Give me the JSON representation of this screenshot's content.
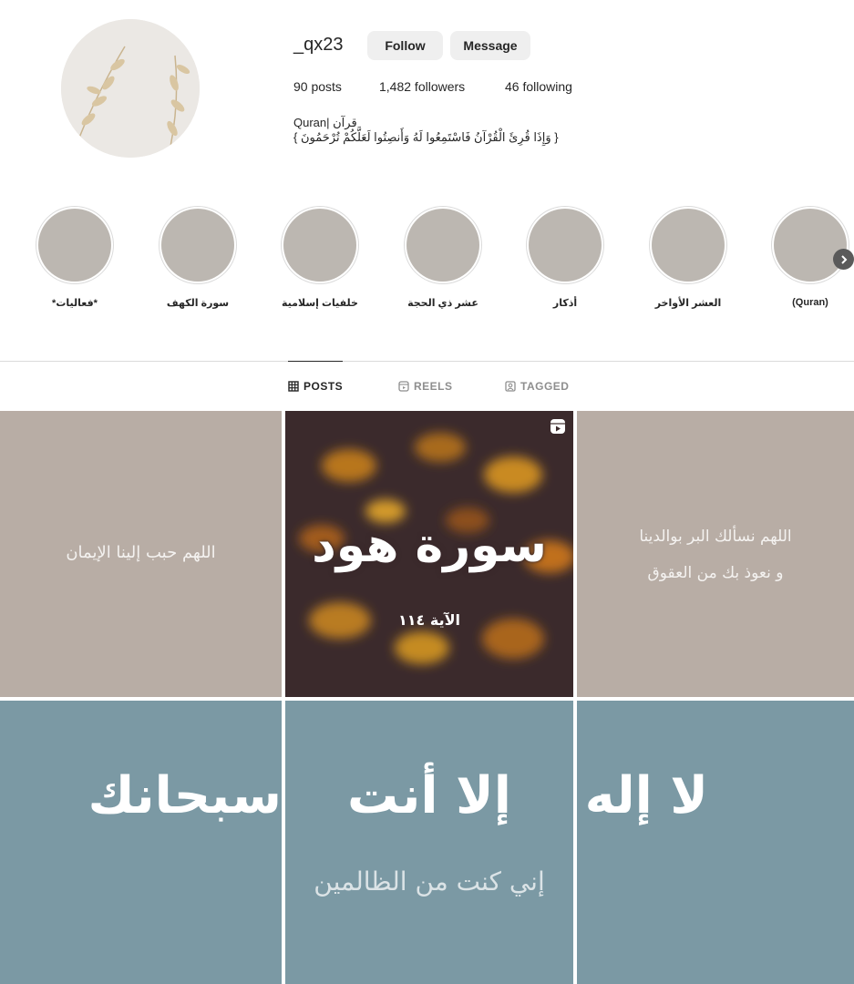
{
  "profile": {
    "username": "_qx23",
    "follow_label": "Follow",
    "message_label": "Message",
    "posts": "90 posts",
    "followers": "1,482 followers",
    "following": "46 following",
    "bio_name": "Quran| قرآن",
    "bio_text": "{ وَإِذَا قُرِئَ الْقُرْآنُ فَاسْتَمِعُوا لَهُ وَأَنصِتُوا لَعَلَّكُمْ تُرْحَمُونَ }"
  },
  "highlights": [
    {
      "label": "*فعاليات*"
    },
    {
      "label": "سورة الكهف"
    },
    {
      "label": "خلفيات إسلامية"
    },
    {
      "label": "عشر ذي الحجة"
    },
    {
      "label": "أذكار"
    },
    {
      "label": "العشر الأواخر"
    },
    {
      "label": "(Quran)"
    }
  ],
  "tabs": {
    "posts": "POSTS",
    "reels": "REELS",
    "tagged": "TAGGED"
  },
  "posts": {
    "post1_text": "اللهم حبب إلينا الإيمان",
    "post2_title": "سورة هود",
    "post2_verse": "الآية ١١٤",
    "post3_line1": "اللهم نسألك البر بوالدينا",
    "post3_line2": "و نعوذ بك من العقوق",
    "post4_part": "سبحانك",
    "post5_part": "إلا أنت",
    "post5_sub": "إني كنت من الظالمين",
    "post6_part": "لا إله"
  },
  "colors": {
    "beige_post": "#b8ada5",
    "blue_post": "#7b99a4",
    "highlight_fill": "#bcb7b1"
  }
}
